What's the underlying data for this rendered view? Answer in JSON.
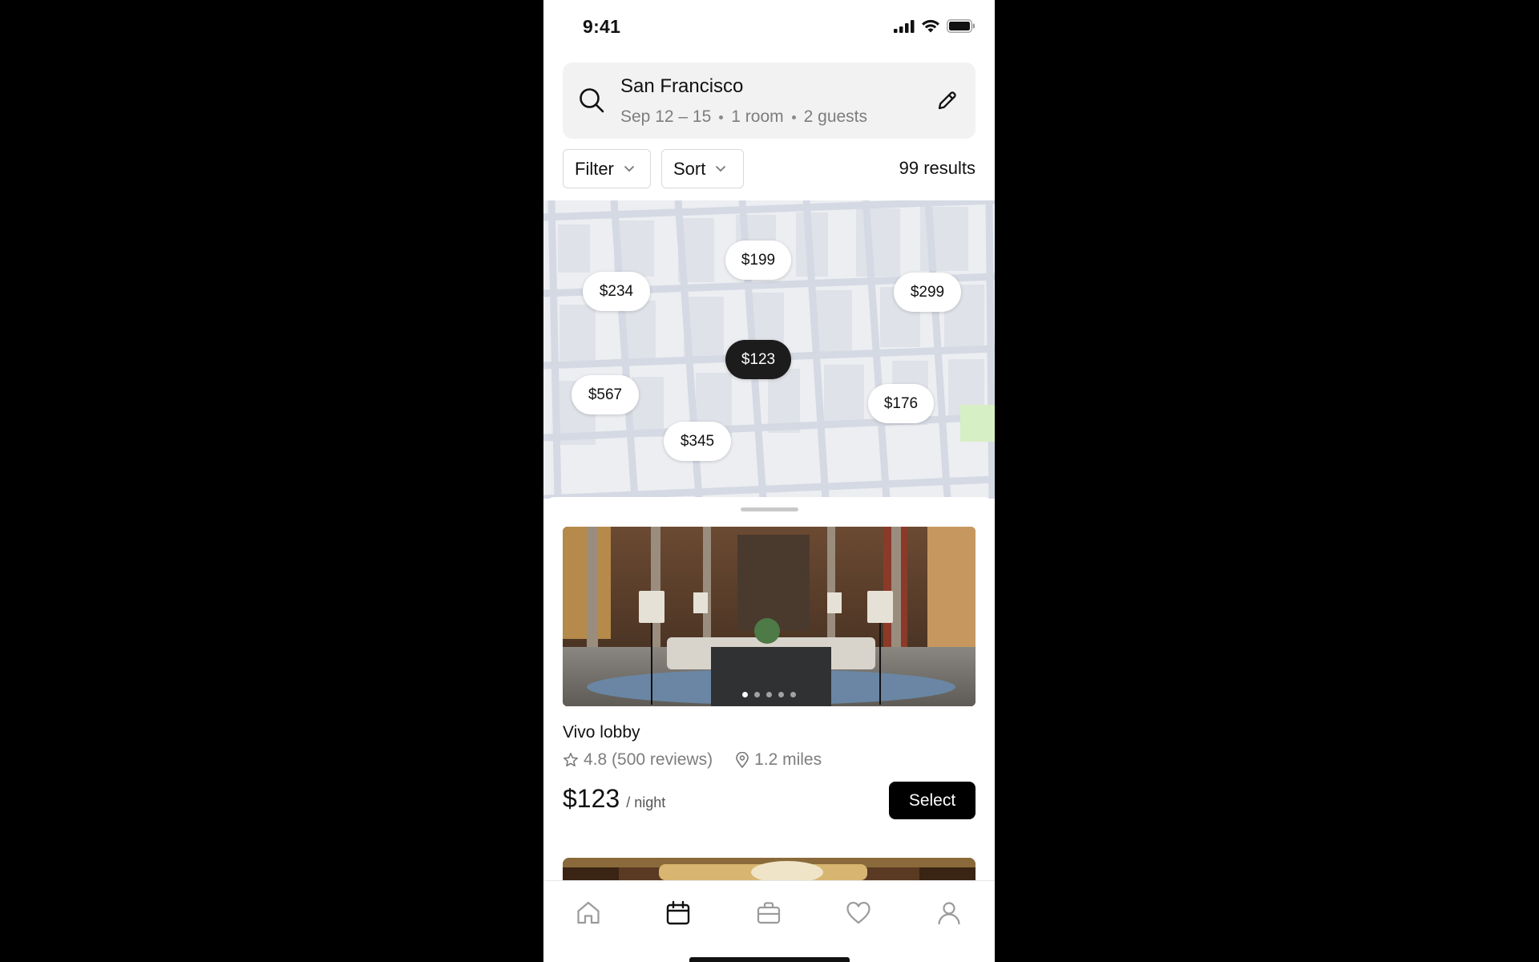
{
  "status_bar": {
    "time": "9:41"
  },
  "search": {
    "city": "San Francisco",
    "dates": "Sep 12 – 15",
    "rooms": "1 room",
    "guests": "2 guests"
  },
  "controls": {
    "filter_label": "Filter",
    "sort_label": "Sort",
    "results": "99 results"
  },
  "map": {
    "pins": [
      {
        "price": "$199",
        "selected": false
      },
      {
        "price": "$234",
        "selected": false
      },
      {
        "price": "$299",
        "selected": false
      },
      {
        "price": "$123",
        "selected": true
      },
      {
        "price": "$567",
        "selected": false
      },
      {
        "price": "$176",
        "selected": false
      },
      {
        "price": "$345",
        "selected": false
      }
    ]
  },
  "listing": {
    "name": "Vivo lobby",
    "rating": "4.8 (500 reviews)",
    "distance": "1.2 miles",
    "price": "$123",
    "per_night": "/ night",
    "select_label": "Select",
    "photo_count": 5,
    "photo_index": 1
  },
  "tabs": [
    {
      "icon": "home-icon",
      "active": false
    },
    {
      "icon": "calendar-icon",
      "active": true
    },
    {
      "icon": "briefcase-icon",
      "active": false
    },
    {
      "icon": "heart-icon",
      "active": false
    },
    {
      "icon": "profile-icon",
      "active": false
    }
  ],
  "colors": {
    "primary": "#000000",
    "map_bg": "#eceef2",
    "map_road": "#d4d9e3",
    "muted_text": "#7d7d7d"
  }
}
